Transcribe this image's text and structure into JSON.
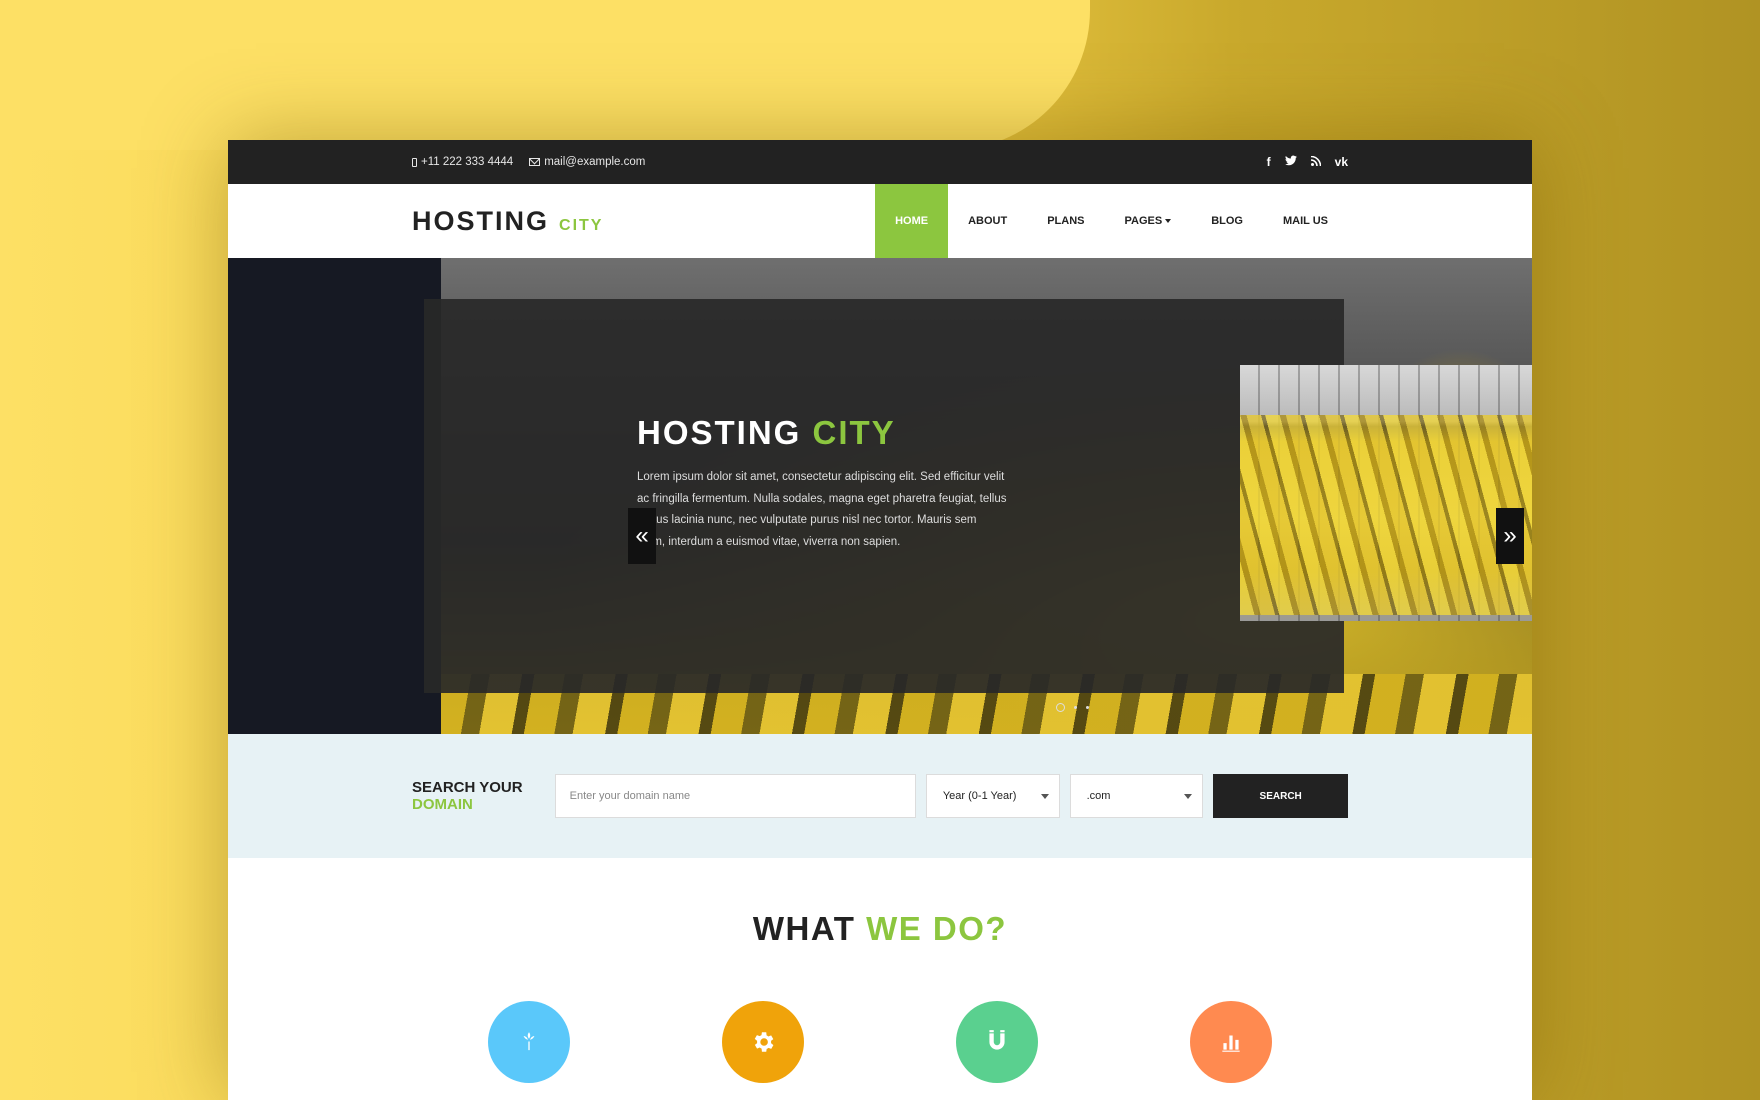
{
  "topbar": {
    "phone": "+11 222 333 4444",
    "email": "mail@example.com",
    "social": [
      {
        "icon": "facebook-icon",
        "glyph": "f"
      },
      {
        "icon": "twitter-icon",
        "glyph": "t"
      },
      {
        "icon": "rss-icon",
        "glyph": "◉"
      },
      {
        "icon": "vk-icon",
        "glyph": "vk"
      }
    ]
  },
  "brand": {
    "main": "HOSTING",
    "sub": "CITY"
  },
  "nav": {
    "home": "HOME",
    "about": "ABOUT",
    "plans": "PLANS",
    "pages": "PAGES",
    "blog": "BLOG",
    "mail": "MAIL US"
  },
  "hero": {
    "title_main": "HOSTING",
    "title_accent": "CITY",
    "text": "Lorem ipsum dolor sit amet, consectetur adipiscing elit. Sed efficitur velit ac fringilla fermentum. Nulla sodales, magna eget pharetra feugiat, tellus metus lacinia nunc, nec vulputate purus nisl nec tortor. Mauris sem diam, interdum a euismod vitae, viverra non sapien.",
    "prev_glyph": "«",
    "next_glyph": "»",
    "slides_count": 3,
    "active_slide": 1
  },
  "search": {
    "label_line1": "SEARCH YOUR",
    "label_line2": "DOMAIN",
    "placeholder": "Enter your domain name",
    "year_select": "Year (0-1 Year)",
    "tld_select": ".com",
    "button": "SEARCH"
  },
  "what_we_do": {
    "title_main": "WHAT",
    "title_accent": "WE DO?"
  },
  "colors": {
    "accent": "#8cc63f",
    "feature_1": "#5ac8fa",
    "feature_2": "#f0a30a",
    "feature_3": "#5ad08f",
    "feature_4": "#ff8a50"
  }
}
